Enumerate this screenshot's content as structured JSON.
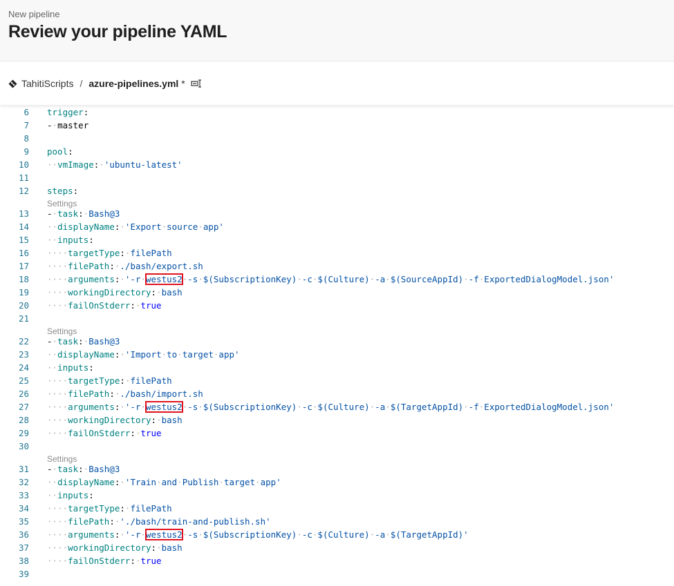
{
  "header": {
    "subtitle": "New pipeline",
    "title": "Review your pipeline YAML"
  },
  "breadcrumb": {
    "repo": "TahitiScripts",
    "separator": "/",
    "file": "azure-pipelines.yml",
    "dirty_marker": "*"
  },
  "editor": {
    "settings_label": "Settings",
    "highlight_token": "westus2",
    "lines": [
      {
        "n": "6",
        "text": "trigger:"
      },
      {
        "n": "7",
        "text": "- master"
      },
      {
        "n": "8",
        "text": ""
      },
      {
        "n": "9",
        "text": "pool:"
      },
      {
        "n": "10",
        "text": "  vmImage: 'ubuntu-latest'"
      },
      {
        "n": "11",
        "text": ""
      },
      {
        "n": "12",
        "text": "steps:"
      },
      {
        "settings": true
      },
      {
        "n": "13",
        "text": "- task: Bash@3"
      },
      {
        "n": "14",
        "text": "  displayName: 'Export source app'"
      },
      {
        "n": "15",
        "text": "  inputs:"
      },
      {
        "n": "16",
        "text": "    targetType: filePath"
      },
      {
        "n": "17",
        "text": "    filePath: ./bash/export.sh"
      },
      {
        "n": "18",
        "text": "    arguments: '-r westus2 -s $(SubscriptionKey) -c $(Culture) -a $(SourceAppId) -f ExportedDialogModel.json'"
      },
      {
        "n": "19",
        "text": "    workingDirectory: bash"
      },
      {
        "n": "20",
        "text": "    failOnStderr: true"
      },
      {
        "n": "21",
        "text": ""
      },
      {
        "settings": true
      },
      {
        "n": "22",
        "text": "- task: Bash@3"
      },
      {
        "n": "23",
        "text": "  displayName: 'Import to target app'"
      },
      {
        "n": "24",
        "text": "  inputs:"
      },
      {
        "n": "25",
        "text": "    targetType: filePath"
      },
      {
        "n": "26",
        "text": "    filePath: ./bash/import.sh"
      },
      {
        "n": "27",
        "text": "    arguments: '-r westus2 -s $(SubscriptionKey) -c $(Culture) -a $(TargetAppId) -f ExportedDialogModel.json'"
      },
      {
        "n": "28",
        "text": "    workingDirectory: bash"
      },
      {
        "n": "29",
        "text": "    failOnStderr: true"
      },
      {
        "n": "30",
        "text": ""
      },
      {
        "settings": true
      },
      {
        "n": "31",
        "text": "- task: Bash@3"
      },
      {
        "n": "32",
        "text": "  displayName: 'Train and Publish target app'"
      },
      {
        "n": "33",
        "text": "  inputs:"
      },
      {
        "n": "34",
        "text": "    targetType: filePath"
      },
      {
        "n": "35",
        "text": "    filePath: './bash/train-and-publish.sh'"
      },
      {
        "n": "36",
        "text": "    arguments: '-r westus2 -s $(SubscriptionKey) -c $(Culture) -a $(TargetAppId)'"
      },
      {
        "n": "37",
        "text": "    workingDirectory: bash"
      },
      {
        "n": "38",
        "text": "    failOnStderr: true"
      },
      {
        "n": "39",
        "text": ""
      }
    ]
  }
}
